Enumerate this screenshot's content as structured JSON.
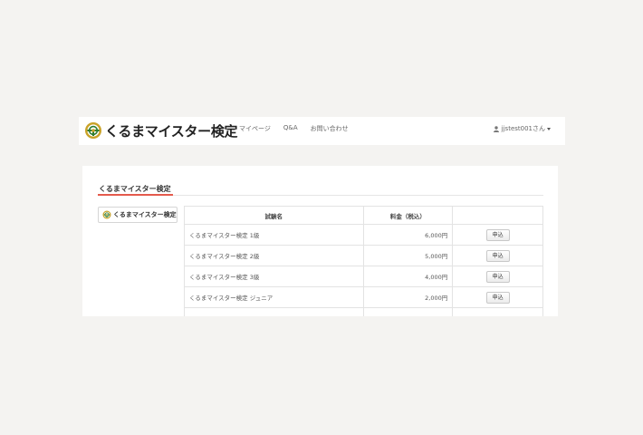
{
  "navbar": {
    "brand_text": "くるまマイスター検定",
    "links": [
      "マイページ",
      "Q&A",
      "お問い合わせ"
    ],
    "user_label": "jjstest001さん"
  },
  "panel": {
    "title": "くるまマイスター検定",
    "side_badge_text": "くるまマイスター検定"
  },
  "table": {
    "headers": [
      "試験名",
      "料金（税込）",
      ""
    ],
    "rows": [
      {
        "name": "くるまマイスター検定 1級",
        "fee": "6,000円",
        "action": "申込"
      },
      {
        "name": "くるまマイスター検定 2級",
        "fee": "5,000円",
        "action": "申込"
      },
      {
        "name": "くるまマイスター検定 3級",
        "fee": "4,000円",
        "action": "申込"
      },
      {
        "name": "くるまマイスター検定 ジュニア",
        "fee": "2,000円",
        "action": "申込"
      },
      {
        "name": "",
        "fee": "",
        "action": ""
      }
    ]
  },
  "colors": {
    "accent_underline": "#e45a4d",
    "logo_gold": "#c9a227",
    "logo_green": "#2e7d32",
    "page_background": "#f4f3f1"
  }
}
